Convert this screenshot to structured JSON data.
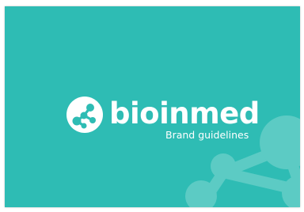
{
  "brand": {
    "name": "bioinmed",
    "tagline": "Brand guidelines"
  },
  "colors": {
    "background": "#2ebcb4",
    "text": "#ffffff",
    "watermark": "#5ccbc4"
  },
  "icons": {
    "logo": "molecule-logo-icon",
    "decoration": "molecule-watermark-icon"
  }
}
